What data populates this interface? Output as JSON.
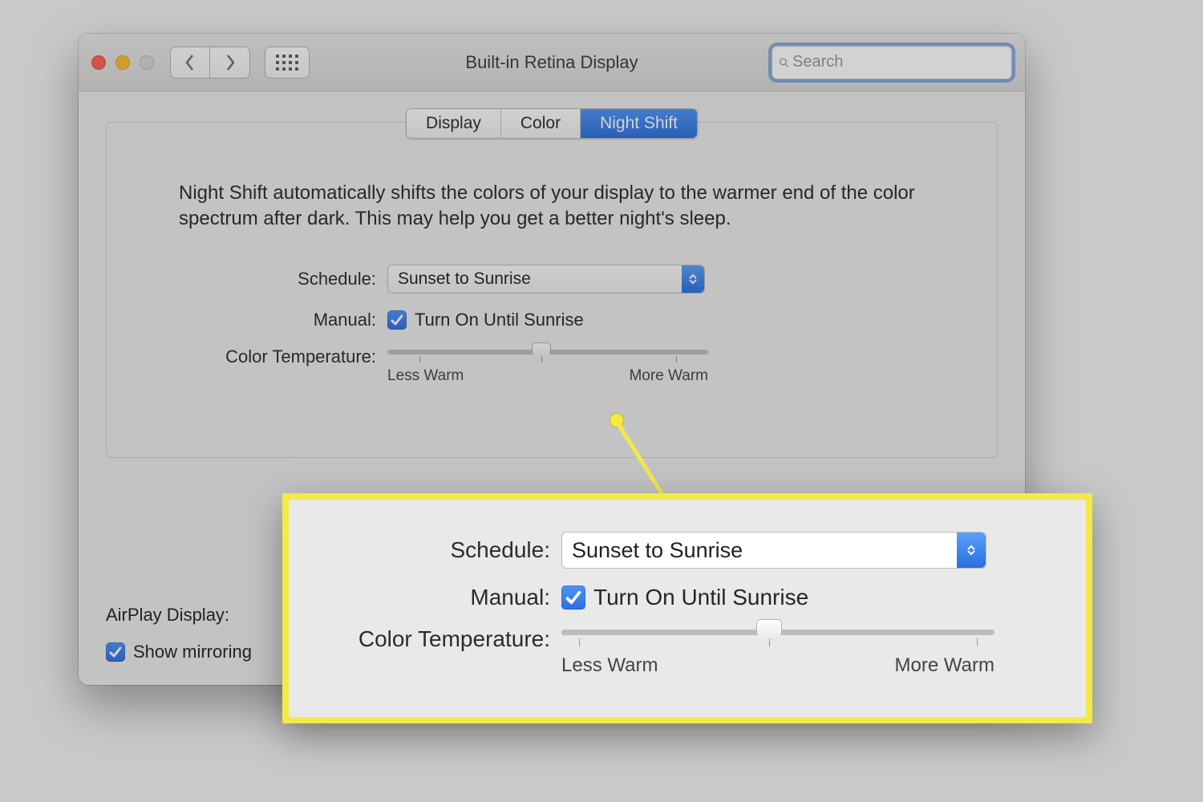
{
  "window": {
    "title": "Built-in Retina Display"
  },
  "search": {
    "placeholder": "Search"
  },
  "tabs": {
    "display": "Display",
    "color": "Color",
    "nightshift": "Night Shift"
  },
  "nightshift": {
    "description": "Night Shift automatically shifts the colors of your display to the warmer end of the color spectrum after dark. This may help you get a better night's sleep.",
    "labels": {
      "schedule": "Schedule:",
      "manual": "Manual:",
      "colortemp": "Color Temperature:"
    },
    "schedule_value": "Sunset to Sunrise",
    "manual_text": "Turn On Until Sunrise",
    "slider": {
      "less": "Less Warm",
      "more": "More Warm",
      "value_percent": 48
    }
  },
  "bottom": {
    "airplay_label": "AirPlay Display:",
    "mirroring_label": "Show mirroring"
  }
}
